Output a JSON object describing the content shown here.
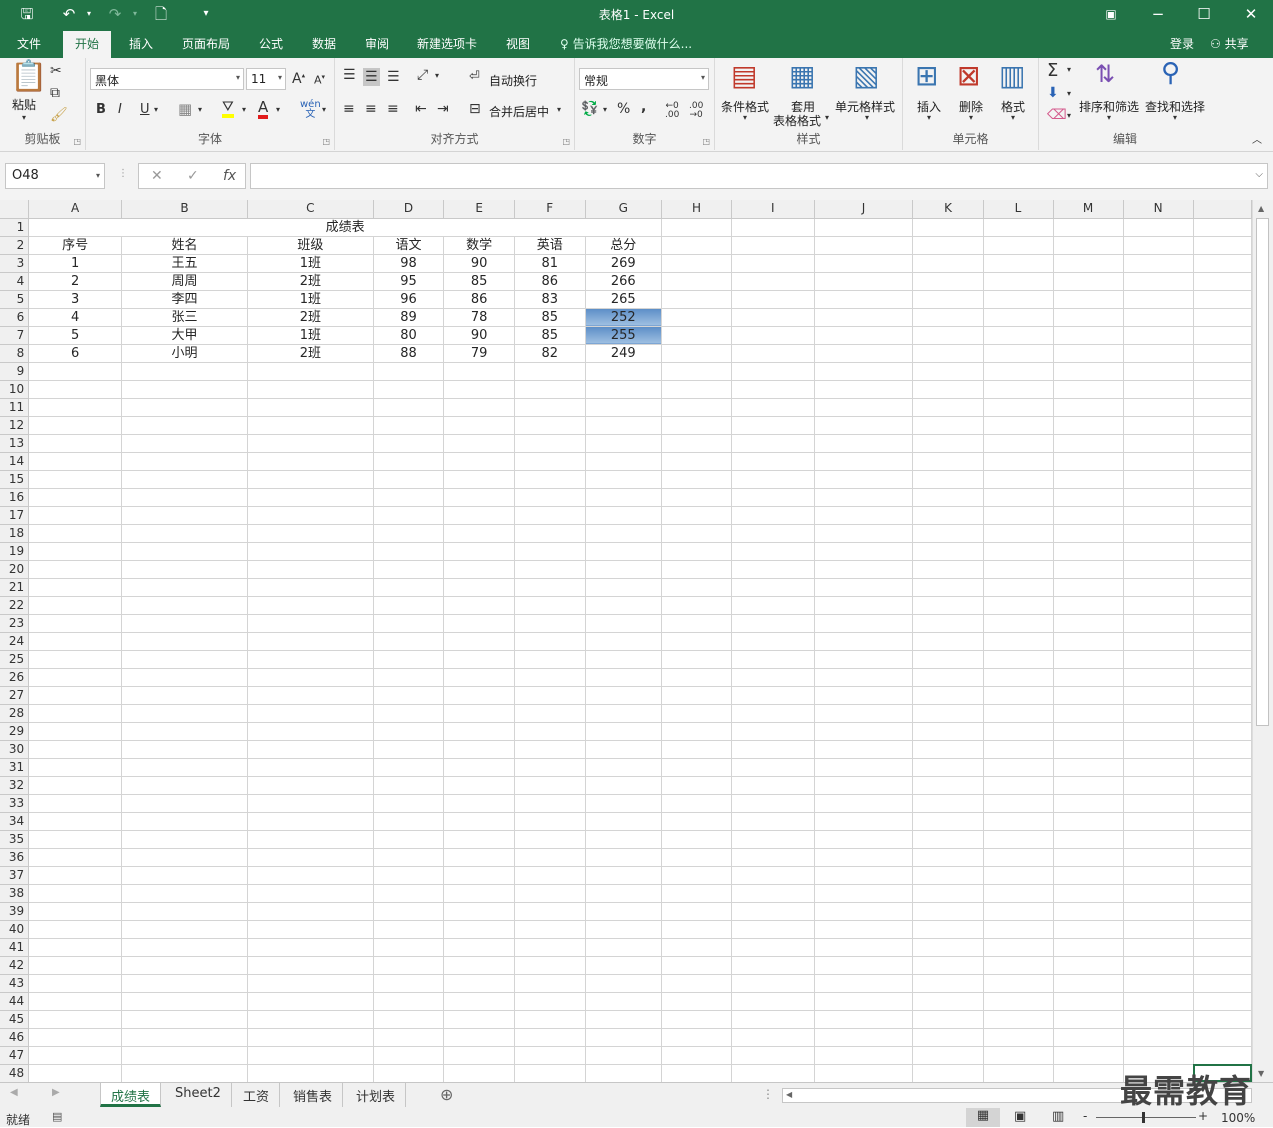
{
  "titlebar": {
    "title": "表格1 - Excel",
    "save_icon": "save-icon",
    "undo_icon": "undo-icon",
    "redo_icon": "redo-icon",
    "new_icon": "new-file-icon"
  },
  "menu": {
    "items": [
      "文件",
      "开始",
      "插入",
      "页面布局",
      "公式",
      "数据",
      "审阅",
      "新建选项卡",
      "视图"
    ],
    "active": "开始",
    "tell_me": "告诉我您想要做什么...",
    "login": "登录",
    "share": "共享"
  },
  "ribbon": {
    "clipboard": {
      "label": "剪贴板",
      "paste": "粘贴"
    },
    "font": {
      "label": "字体",
      "font_name": "黑体",
      "font_size": "11",
      "bold": "B",
      "italic": "I",
      "underline": "U",
      "grow": "A",
      "shrink": "A"
    },
    "alignment": {
      "label": "对齐方式",
      "wrap": "自动换行",
      "merge": "合并后居中"
    },
    "number": {
      "label": "数字",
      "format": "常规",
      "percent": "%",
      "comma": ","
    },
    "styles": {
      "label": "样式",
      "conditional": "条件格式",
      "table_line1": "套用",
      "table_line2": "表格格式",
      "cell_styles": "单元格样式"
    },
    "cells": {
      "label": "单元格",
      "insert": "插入",
      "delete": "删除",
      "format": "格式"
    },
    "editing": {
      "label": "编辑",
      "sort": "排序和筛选",
      "find": "查找和选择"
    }
  },
  "formula_bar": {
    "name_box": "O48",
    "cancel": "✕",
    "enter": "✓",
    "fx": "fx",
    "value": ""
  },
  "sheet": {
    "columns": [
      "A",
      "B",
      "C",
      "D",
      "E",
      "F",
      "G",
      "H",
      "I",
      "J",
      "K",
      "L",
      "M",
      "N"
    ],
    "title": "成绩表",
    "headers": [
      "序号",
      "姓名",
      "班级",
      "语文",
      "数学",
      "英语",
      "总分"
    ],
    "rows": [
      [
        "1",
        "王五",
        "1班",
        "98",
        "90",
        "81",
        "269"
      ],
      [
        "2",
        "周周",
        "2班",
        "95",
        "85",
        "86",
        "266"
      ],
      [
        "3",
        "李四",
        "1班",
        "96",
        "86",
        "83",
        "265"
      ],
      [
        "4",
        "张三",
        "2班",
        "89",
        "78",
        "85",
        "252"
      ],
      [
        "5",
        "大甲",
        "1班",
        "80",
        "90",
        "85",
        "255"
      ],
      [
        "6",
        "小明",
        "2班",
        "88",
        "79",
        "82",
        "249"
      ]
    ],
    "highlighted_rows": [
      3,
      4
    ],
    "highlight_color": "#7aa6d6",
    "row_count": 48
  },
  "tabs": {
    "items": [
      "成绩表",
      "Sheet2",
      "工资",
      "销售表",
      "计划表"
    ],
    "active": "成绩表"
  },
  "status": {
    "ready": "就绪",
    "zoom": "100%",
    "zoom_minus": "-",
    "zoom_plus": "+"
  },
  "watermark": "最需教育",
  "colors": {
    "excel_green": "#217346"
  }
}
